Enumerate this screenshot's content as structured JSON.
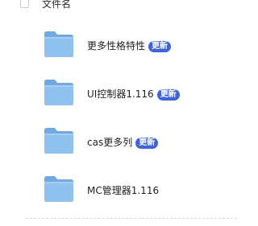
{
  "header": {
    "name_column": "文件名"
  },
  "files": [
    {
      "name": "更多性格特性",
      "badge": "更新"
    },
    {
      "name": "UI控制器1.116",
      "badge": "更新"
    },
    {
      "name": "cas更多列",
      "badge": "更新"
    },
    {
      "name": "MC管理器1.116",
      "badge": ""
    }
  ],
  "colors": {
    "badge": "#3f63d8",
    "folder_body": "#8fc2ef",
    "folder_tab": "#6fa9e0"
  },
  "icons": {
    "folder": "folder-icon",
    "checkbox": "checkbox-icon"
  }
}
